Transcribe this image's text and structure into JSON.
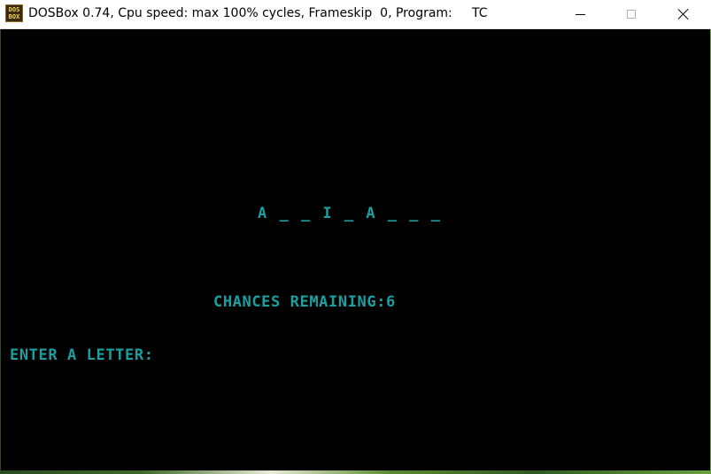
{
  "window": {
    "title": "DOSBox 0.74, Cpu speed: max 100% cycles, Frameskip  0, Program:     TC",
    "icon_label": "DOS BOX"
  },
  "controls": {
    "minimize": "minimize-icon",
    "maximize": "maximize-icon",
    "close": "close-icon"
  },
  "game": {
    "word_display": "A _ _ I _ A _ _ _",
    "chances_label": "CHANCES REMAINING:6",
    "prompt": "ENTER A LETTER:"
  },
  "colors": {
    "text": "#1aa0a0",
    "background": "#000000"
  }
}
